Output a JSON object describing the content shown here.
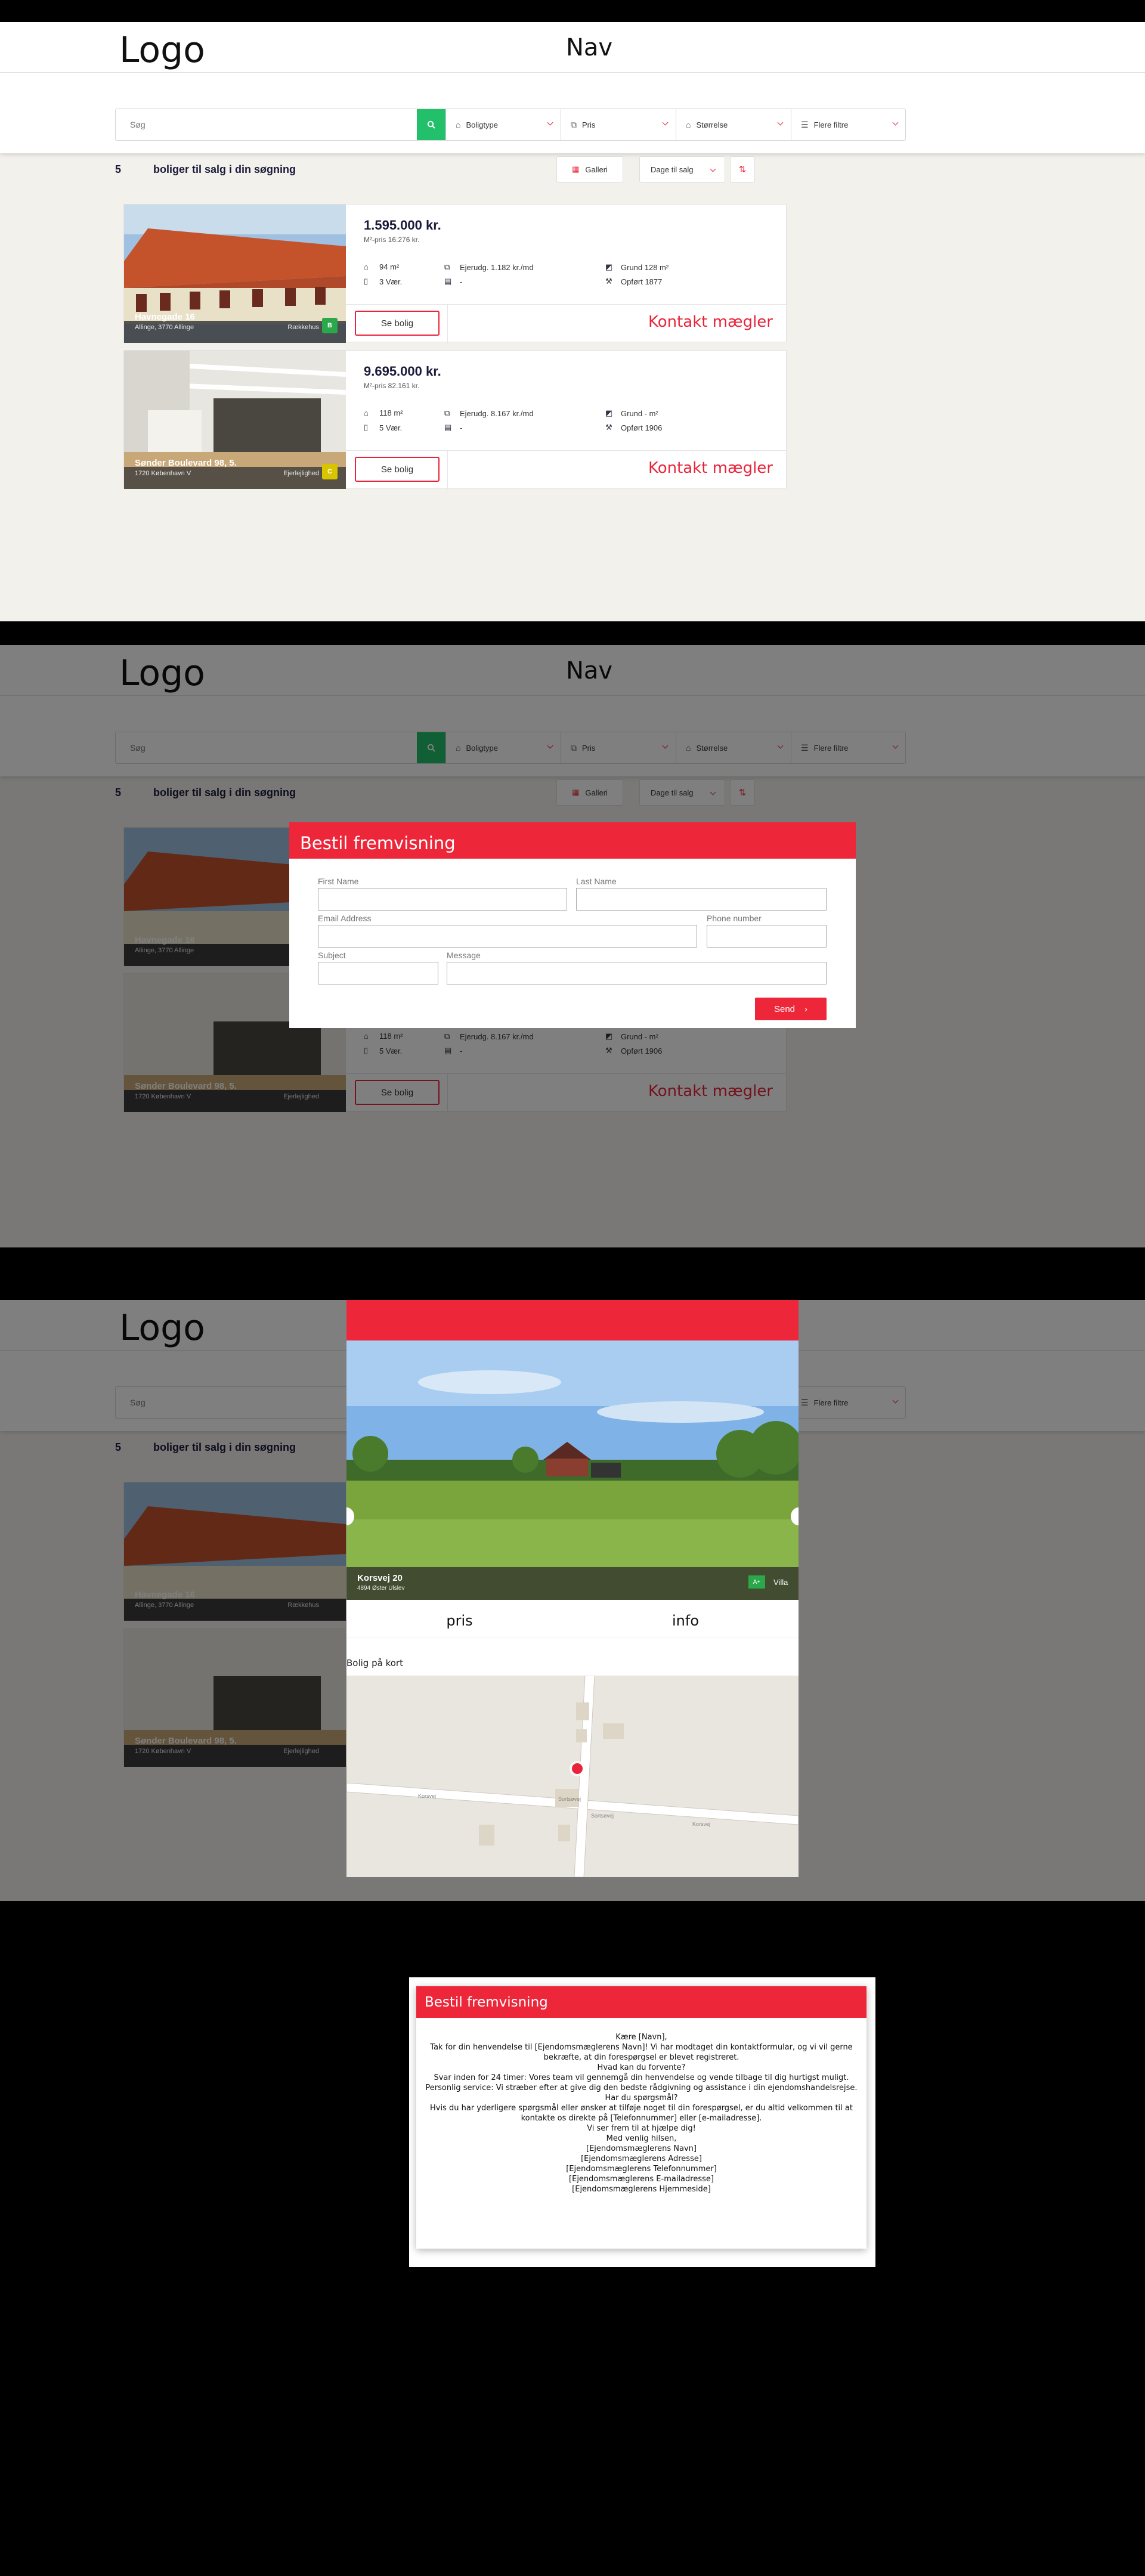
{
  "header": {
    "logo": "Logo",
    "nav": "Nav"
  },
  "search": {
    "placeholder": "Søg",
    "filters": [
      {
        "icon": "house-icon",
        "label": "Boligtype"
      },
      {
        "icon": "price-tag-icon",
        "label": "Pris"
      },
      {
        "icon": "size-icon",
        "label": "Størrelse"
      },
      {
        "icon": "sliders-icon",
        "label": "Flere filtre"
      }
    ]
  },
  "results": {
    "count": "5",
    "label": "boliger til salg i din søgning",
    "gallery": "Galleri",
    "sort": "Dage til salg"
  },
  "listings": [
    {
      "address": "Havnegade 16",
      "city": "Allinge, 3770 Allinge",
      "type": "Rækkehus",
      "energy": "B",
      "energy_color": "#2aa84a",
      "price": "1.595.000 kr.",
      "m2price": "M²-pris 16.276 kr.",
      "area": "94 m²",
      "rooms": "3 Vær.",
      "ejerudg": "Ejerudg. 1.182 kr./md",
      "misc": "-",
      "grund": "Grund 128 m²",
      "built": "Opført 1877",
      "see": "Se bolig",
      "contact": "Kontakt mægler"
    },
    {
      "address": "Sønder Boulevard 98, 5.",
      "city": "1720 København V",
      "type": "Ejerlejlighed",
      "energy": "C",
      "energy_color": "#d9c400",
      "price": "9.695.000 kr.",
      "m2price": "M²-pris 82.161 kr.",
      "area": "118 m²",
      "rooms": "5 Vær.",
      "ejerudg": "Ejerudg. 8.167 kr./md",
      "misc": "-",
      "grund": "Grund - m²",
      "built": "Opført 1906",
      "see": "Se bolig",
      "contact": "Kontakt mægler"
    }
  ],
  "form_modal": {
    "title": "Bestil fremvisning",
    "first_name": "First Name",
    "last_name": "Last Name",
    "email": "Email Address",
    "phone": "Phone number",
    "subject": "Subject",
    "message": "Message",
    "send": "Send"
  },
  "property_modal": {
    "address": "Korsvej 20",
    "city": "4894 Øster Ulslev",
    "type": "Villa",
    "energy": "A+",
    "tab_price": "pris",
    "tab_info": "info",
    "map_label": "Bolig på kort",
    "map_roads": [
      "Korsvej",
      "Sortsøvej",
      "Sortsøvej",
      "Korsvej"
    ]
  },
  "email_modal": {
    "title": "Bestil fremvisning",
    "lines": [
      "Kære [Navn],",
      "Tak for din henvendelse til [Ejendomsmæglerens Navn]! Vi har modtaget din kontaktformular, og vi vil gerne",
      "bekræfte, at din forespørgsel er blevet registreret.",
      "Hvad kan du forvente?",
      "Svar inden for 24 timer: Vores team vil gennemgå din henvendelse og vende tilbage til dig hurtigst muligt.",
      "Personlig service: Vi stræber efter at give dig den bedste rådgivning og assistance i din ejendomshandelsrejse.",
      "Har du spørgsmål?",
      "Hvis du har yderligere spørgsmål eller ønsker at tilføje noget til din forespørgsel, er du altid velkommen til at",
      "kontakte os direkte på [Telefonnummer] eller [e-mailadresse].",
      "Vi ser frem til at hjælpe dig!",
      "Med venlig hilsen,",
      "[Ejendomsmæglerens Navn]",
      "[Ejendomsmæglerens Adresse]",
      "[Ejendomsmæglerens Telefonnummer]",
      "[Ejendomsmæglerens E-mailadresse]",
      "[Ejendomsmæglerens Hjemmeside]"
    ]
  }
}
